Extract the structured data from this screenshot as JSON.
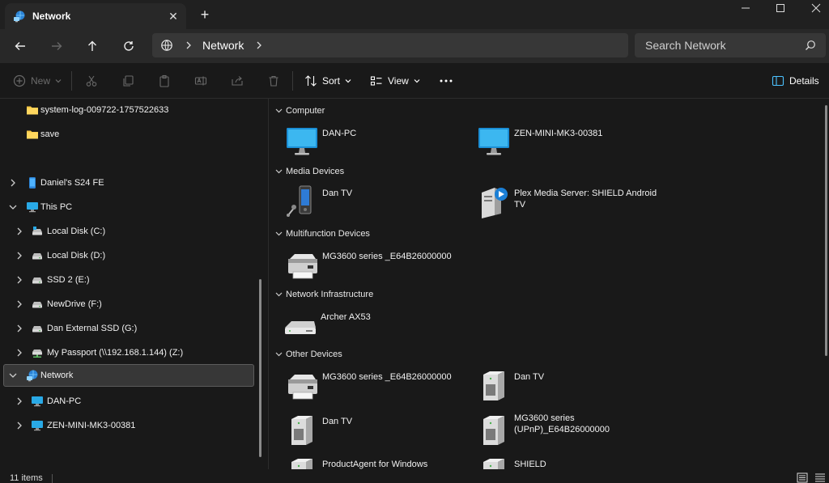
{
  "window": {
    "tab_title": "Network",
    "controls": [
      "minimize-icon",
      "maximize-icon",
      "close-icon"
    ]
  },
  "navigation": {
    "breadcrumb": [
      "Network"
    ],
    "search_placeholder": "Search Network"
  },
  "commands": {
    "new_label": "New",
    "sort_label": "Sort",
    "view_label": "View",
    "details_label": "Details"
  },
  "sidebar": {
    "items": [
      {
        "label": "system-log-009722-1757522633",
        "icon": "folder-icon"
      },
      {
        "label": "save",
        "icon": "folder-icon"
      },
      {
        "label": "Daniel's S24 FE",
        "icon": "phone-icon"
      },
      {
        "label": "This PC",
        "icon": "monitor-icon"
      },
      {
        "label": "Local Disk (C:)",
        "icon": "system-drive-icon"
      },
      {
        "label": "Local Disk (D:)",
        "icon": "drive-icon"
      },
      {
        "label": "SSD 2 (E:)",
        "icon": "drive-icon"
      },
      {
        "label": "NewDrive (F:)",
        "icon": "drive-icon"
      },
      {
        "label": "Dan External SSD (G:)",
        "icon": "drive-icon"
      },
      {
        "label": "My Passport (\\\\192.168.1.144) (Z:)",
        "icon": "network-drive-icon"
      },
      {
        "label": "Network",
        "icon": "network-icon"
      },
      {
        "label": "DAN-PC",
        "icon": "monitor-icon"
      },
      {
        "label": "ZEN-MINI-MK3-00381",
        "icon": "monitor-icon"
      }
    ]
  },
  "groups": [
    {
      "title": "Computer",
      "items": [
        {
          "label": "DAN-PC",
          "icon": "computer-icon"
        },
        {
          "label": "ZEN-MINI-MK3-00381",
          "icon": "computer-icon"
        }
      ]
    },
    {
      "title": "Media Devices",
      "items": [
        {
          "label": "Dan TV",
          "icon": "media-device-icon"
        },
        {
          "label": "Plex Media Server: SHIELD Android TV",
          "icon": "media-server-icon"
        }
      ]
    },
    {
      "title": "Multifunction Devices",
      "items": [
        {
          "label": "MG3600 series _E64B26000000",
          "icon": "printer-icon"
        }
      ]
    },
    {
      "title": "Network Infrastructure",
      "items": [
        {
          "label": "Archer AX53",
          "icon": "router-icon"
        }
      ]
    },
    {
      "title": "Other Devices",
      "items": [
        {
          "label": "MG3600 series _E64B26000000",
          "icon": "printer-icon"
        },
        {
          "label": "Dan TV",
          "icon": "device-tower-icon"
        },
        {
          "label": "Dan TV",
          "icon": "device-tower-icon"
        },
        {
          "label": "MG3600 series (UPnP)_E64B26000000",
          "icon": "device-tower-icon"
        },
        {
          "label": "ProductAgent for Windows",
          "icon": "device-tower-icon"
        },
        {
          "label": "SHIELD",
          "icon": "device-tower-icon"
        }
      ]
    }
  ],
  "status": {
    "item_count": "11 items",
    "views": [
      "details-view-icon",
      "tiles-view-icon"
    ]
  },
  "colors": {
    "accent": "#4cc2ff",
    "folder": "#f4c542",
    "monitor": "#29a9e6"
  }
}
